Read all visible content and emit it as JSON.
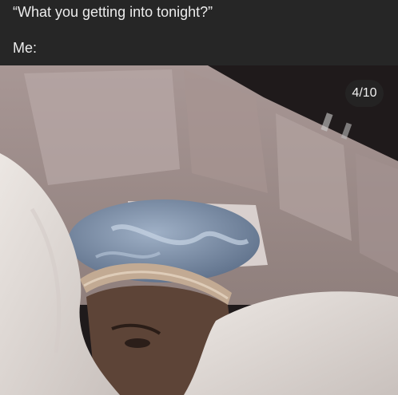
{
  "caption": {
    "line1": "“What you getting into tonight?”",
    "line2": "Me:"
  },
  "media": {
    "counter": "4/10",
    "description_icon": "photo-bed-bonnet"
  },
  "colors": {
    "caption_bg": "#262626",
    "caption_text": "#ececec",
    "headboard": "#b3a5a3",
    "blanket": "#e3ddd9",
    "bonnet_blue": "#7d8fa9",
    "bonnet_trim": "#bda690",
    "counter_bg": "#262626"
  }
}
